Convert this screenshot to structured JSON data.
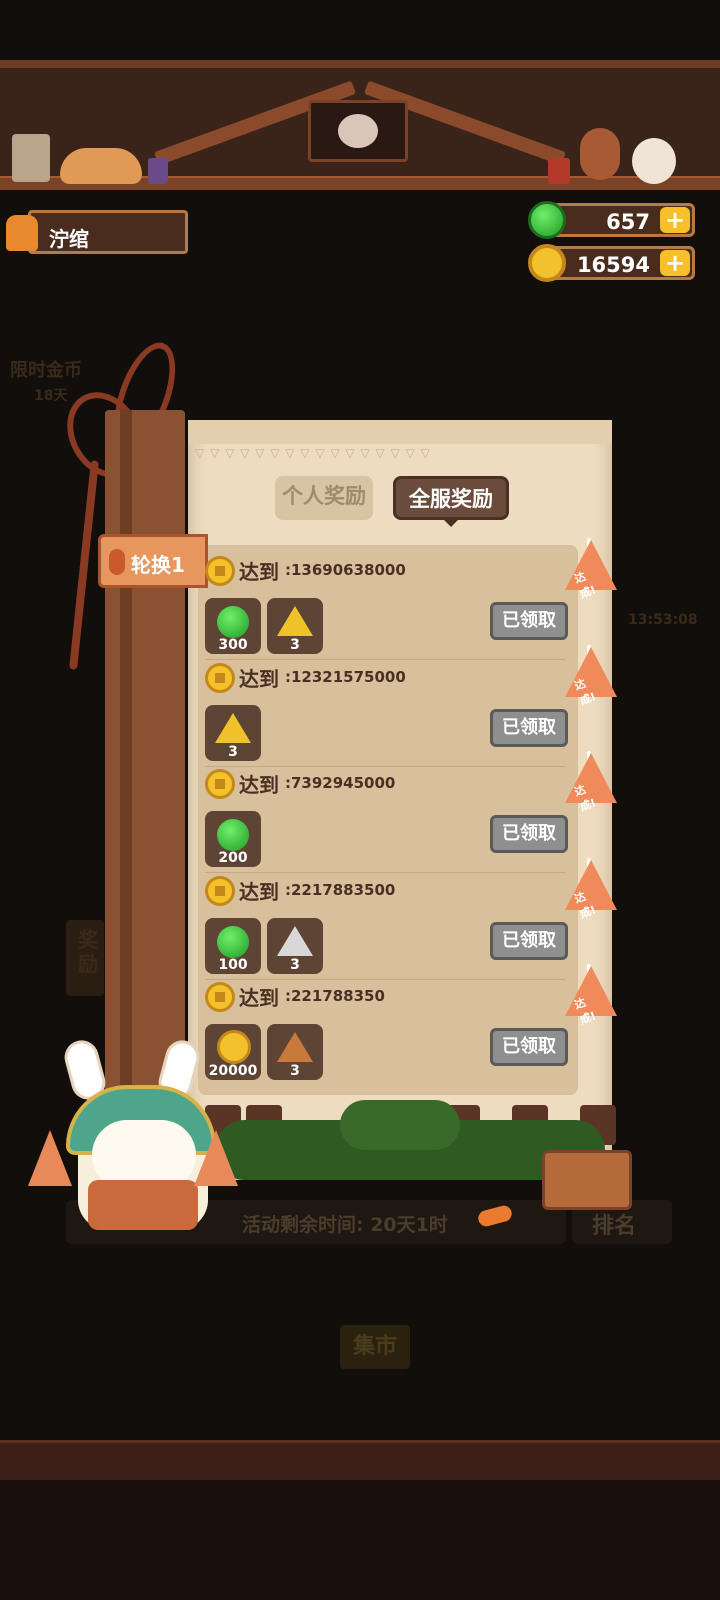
{
  "header": {
    "user_name": "泞绾"
  },
  "currency": {
    "gems": "657",
    "coins": "16594",
    "plus_symbol": "+"
  },
  "panel": {
    "tabs": [
      {
        "label": "个人奖励",
        "active": false
      },
      {
        "label": "全服奖励",
        "active": true
      }
    ],
    "rotation_label": "轮换1",
    "reach_label": "达到",
    "rows": [
      {
        "target": ":13690638000",
        "items": [
          {
            "icon": "green-gem-icon",
            "qty": "300"
          },
          {
            "icon": "gold-fragment-icon",
            "qty": "3"
          }
        ],
        "button": "已领取",
        "flag": "达成!"
      },
      {
        "target": ":12321575000",
        "items": [
          {
            "icon": "gold-fragment-icon",
            "qty": "3"
          }
        ],
        "button": "已领取",
        "flag": "达成!"
      },
      {
        "target": ":7392945000",
        "items": [
          {
            "icon": "green-gem-icon",
            "qty": "200"
          }
        ],
        "button": "已领取",
        "flag": "达成!"
      },
      {
        "target": ":2217883500",
        "items": [
          {
            "icon": "green-gem-icon",
            "qty": "100"
          },
          {
            "icon": "silver-fragment-icon",
            "qty": "3"
          }
        ],
        "button": "已领取",
        "flag": "达成!"
      },
      {
        "target": ":221788350",
        "items": [
          {
            "icon": "gold-coin-icon",
            "qty": "20000"
          },
          {
            "icon": "bronze-fragment-icon",
            "qty": "3"
          }
        ],
        "button": "已领取",
        "flag": "达成!"
      }
    ]
  },
  "footer": {
    "time_remaining": "活动剩余时间: 20天1时",
    "rank_label": "排名",
    "market_label": "集市"
  },
  "background_hints": {
    "left_label": "限时金币",
    "left_days": "18天",
    "right_timer": "13:53:08",
    "side_tab": "奖励"
  },
  "colors": {
    "paper": "#eddcc0",
    "accent_orange": "#e7965e",
    "claimed_button": "#8f8f8f",
    "gold": "#f3c12c",
    "gem_green": "#2fbf35"
  }
}
